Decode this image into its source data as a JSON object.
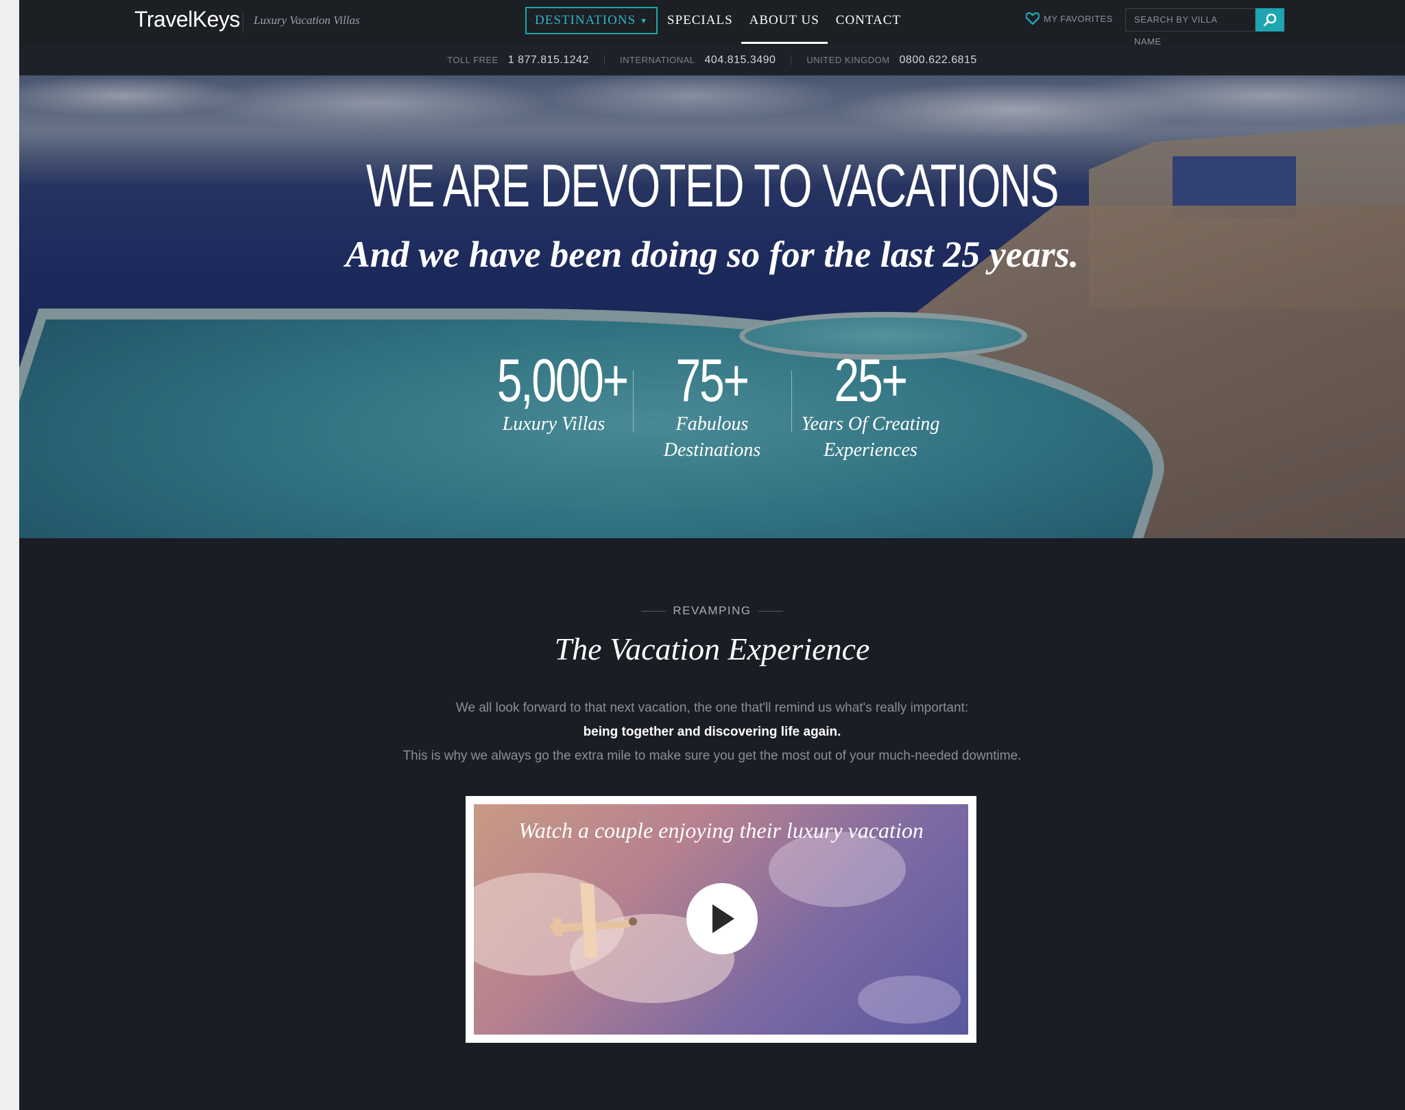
{
  "header": {
    "logo": "TravelKeys",
    "tagline": "Luxury Vacation Villas",
    "nav": [
      {
        "label": "DESTINATIONS"
      },
      {
        "label": "SPECIALS"
      },
      {
        "label": "ABOUT US"
      },
      {
        "label": "CONTACT"
      }
    ],
    "favorites_label": "MY FAVORITES",
    "search_placeholder": "SEARCH BY VILLA NAME",
    "accent_color": "#1ea5b0"
  },
  "phones": [
    {
      "label": "TOLL FREE",
      "number": "1 877.815.1242"
    },
    {
      "label": "INTERNATIONAL",
      "number": "404.815.3490"
    },
    {
      "label": "UNITED KINGDOM",
      "number": "0800.622.6815"
    }
  ],
  "hero": {
    "title": "WE ARE DEVOTED TO VACATIONS",
    "subtitle": "And we have been doing so for the last 25 years.",
    "stats": [
      {
        "number": "5,000+",
        "label": "Luxury Villas"
      },
      {
        "number": "75+",
        "label": "Fabulous Destinations"
      },
      {
        "number": "25+",
        "label": "Years Of Creating Experiences"
      }
    ]
  },
  "section": {
    "eyebrow": "REVAMPING",
    "title": "The Vacation Experience",
    "line1": "We all look forward to that next vacation, the one that'll remind us what's really important:",
    "line2": "being together and discovering life again.",
    "line3": "This is why we always go the extra mile to make sure you get the most out of your much-needed downtime.",
    "video_caption": "Watch a couple enjoying their luxury vacation"
  }
}
